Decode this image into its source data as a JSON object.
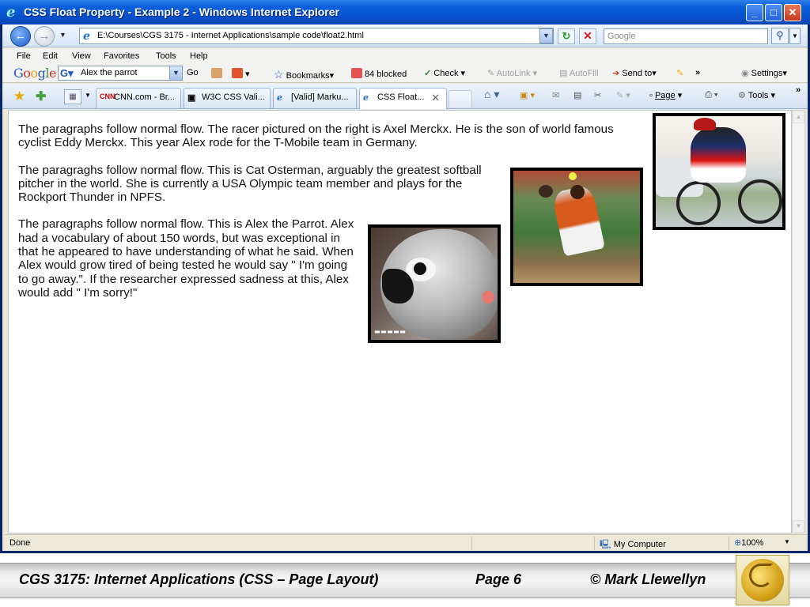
{
  "window": {
    "title": "CSS Float Property - Example 2 - Windows Internet Explorer",
    "min_label": "_",
    "max_label": "□",
    "close_label": "✕"
  },
  "address_bar": {
    "url": "E:\\Courses\\CGS 3175 - Internet Applications\\sample code\\float2.html",
    "search_placeholder": "Google"
  },
  "menu": {
    "items": [
      "File",
      "Edit",
      "View",
      "Favorites",
      "Tools",
      "Help"
    ]
  },
  "google_toolbar": {
    "logo": "Google",
    "search_value": "Alex the parrot",
    "go_label": "Go",
    "bookmarks_label": "Bookmarks",
    "blocked_label": "84 blocked",
    "check_label": "Check",
    "autolink_label": "AutoLink",
    "autofill_label": "AutoFill",
    "sendto_label": "Send to",
    "more_label": "»",
    "settings_label": "Settings"
  },
  "tabs": {
    "items": [
      {
        "label": "CNN.com - Br...",
        "icon": "cnn-icon"
      },
      {
        "label": "W3C CSS Vali...",
        "icon": "w3c-icon"
      },
      {
        "label": "[Valid] Marku...",
        "icon": "ie-page-icon"
      },
      {
        "label": "CSS Float...",
        "icon": "ie-page-icon",
        "active": true
      }
    ],
    "page_label": "Page",
    "tools_label": "Tools",
    "more_label": "»"
  },
  "content": {
    "paragraphs": [
      "The paragraphs follow normal flow. The racer pictured on the right is Axel Merckx. He is the son of world famous cyclist Eddy Merckx. This year Alex rode for the T-Mobile team in Germany.",
      "The paragraghs follow normal flow. This is Cat Osterman, arguably the greatest softball pitcher in the world. She is currently a USA Olympic team member and plays for the Rockport Thunder in NPFS.",
      "The paragraphs follow normal flow. This is Alex the Parrot. Alex had a vocabulary of about 150 words, but was exceptional in that he appeared to have understanding of what he said. When Alex would grow tired of being tested he would say \" I'm going to go away.\". If the researcher expressed sadness at this, Alex would add \" I'm sorry!\""
    ]
  },
  "status_bar": {
    "status": "Done",
    "zone": "My Computer",
    "zoom": "100%"
  },
  "footer": {
    "course": "CGS 3175: Internet Applications (CSS – Page Layout)",
    "page": "Page 6",
    "author": "© Mark Llewellyn"
  }
}
